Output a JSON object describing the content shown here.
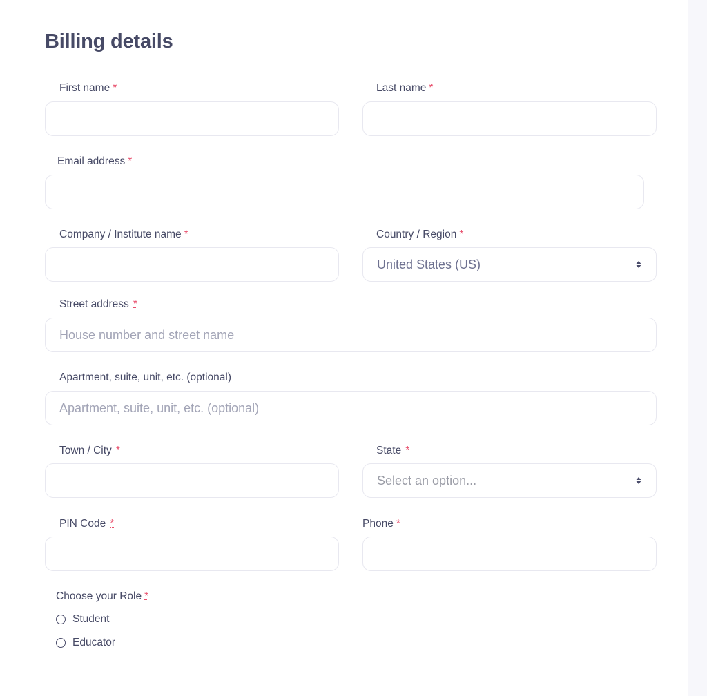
{
  "title": "Billing details",
  "fields": {
    "first_name": {
      "label": "First name",
      "required_mark": "*",
      "value": ""
    },
    "last_name": {
      "label": "Last name",
      "required_mark": "*",
      "value": ""
    },
    "email": {
      "label": "Email address",
      "required_mark": "*",
      "value": ""
    },
    "company": {
      "label": "Company / Institute name",
      "required_mark": "*",
      "value": ""
    },
    "country": {
      "label": "Country / Region",
      "required_mark": "*",
      "selected": "United States (US)"
    },
    "street": {
      "label": "Street address",
      "required_mark": "*",
      "placeholder": "House number and street name",
      "value": ""
    },
    "apartment": {
      "label": "Apartment, suite, unit, etc. (optional)",
      "placeholder": "Apartment, suite, unit, etc. (optional)",
      "value": ""
    },
    "city": {
      "label": "Town / City",
      "required_mark": "*",
      "value": ""
    },
    "state": {
      "label": "State",
      "required_mark": "*",
      "placeholder": "Select an option..."
    },
    "pin": {
      "label": "PIN Code",
      "required_mark": "*",
      "value": ""
    },
    "phone": {
      "label": "Phone",
      "required_mark": "*",
      "value": ""
    }
  },
  "role": {
    "label": "Choose your Role",
    "required_mark": "*",
    "options": [
      {
        "label": "Student",
        "selected": false
      },
      {
        "label": "Educator",
        "selected": false
      }
    ]
  },
  "colors": {
    "required": "#e8506d",
    "text": "#474a66",
    "border": "#e8e8f0",
    "panel": "#f7f7fb"
  }
}
